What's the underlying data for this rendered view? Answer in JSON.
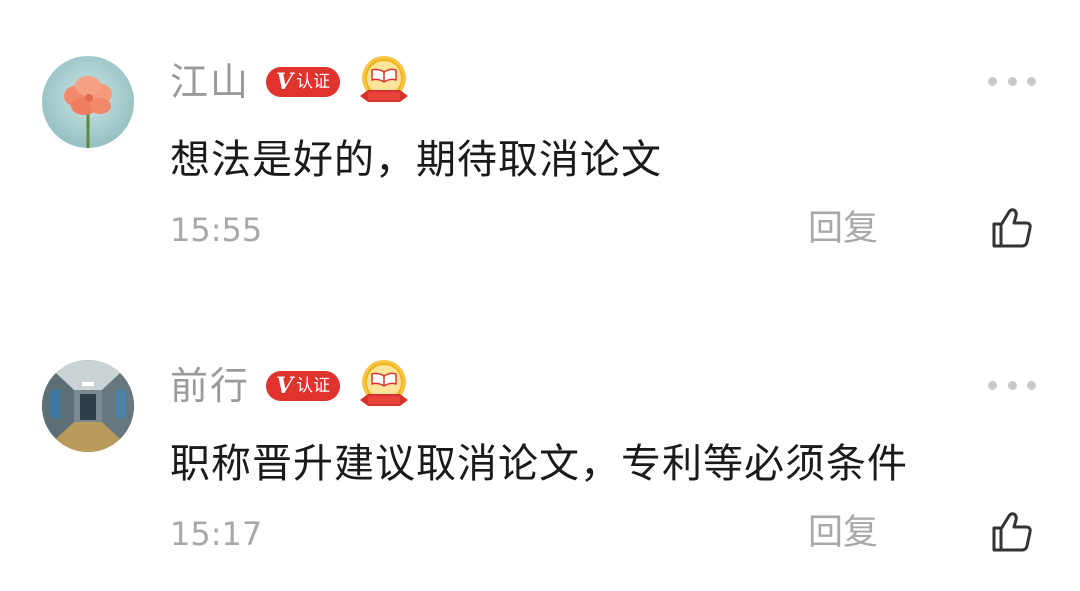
{
  "comments": [
    {
      "username": "江山",
      "verified_label": "认证",
      "verified_mark": "V",
      "content": "想法是好的，期待取消论文",
      "time": "15:55",
      "reply_label": "回复"
    },
    {
      "username": "前行",
      "verified_label": "认证",
      "verified_mark": "V",
      "content": "职称晋升建议取消论文，专利等必须条件",
      "time": "15:17",
      "reply_label": "回复"
    }
  ],
  "icons": {
    "more": "more-dots-icon",
    "like": "thumbs-up-icon",
    "medal": "medal-badge-icon"
  },
  "colors": {
    "verified_badge": "#e0332d",
    "medal_gold": "#f2b31b",
    "medal_ribbon": "#d9342b",
    "username": "#9a9a9a",
    "content": "#1a1a1a",
    "meta": "#a8a8a8"
  }
}
